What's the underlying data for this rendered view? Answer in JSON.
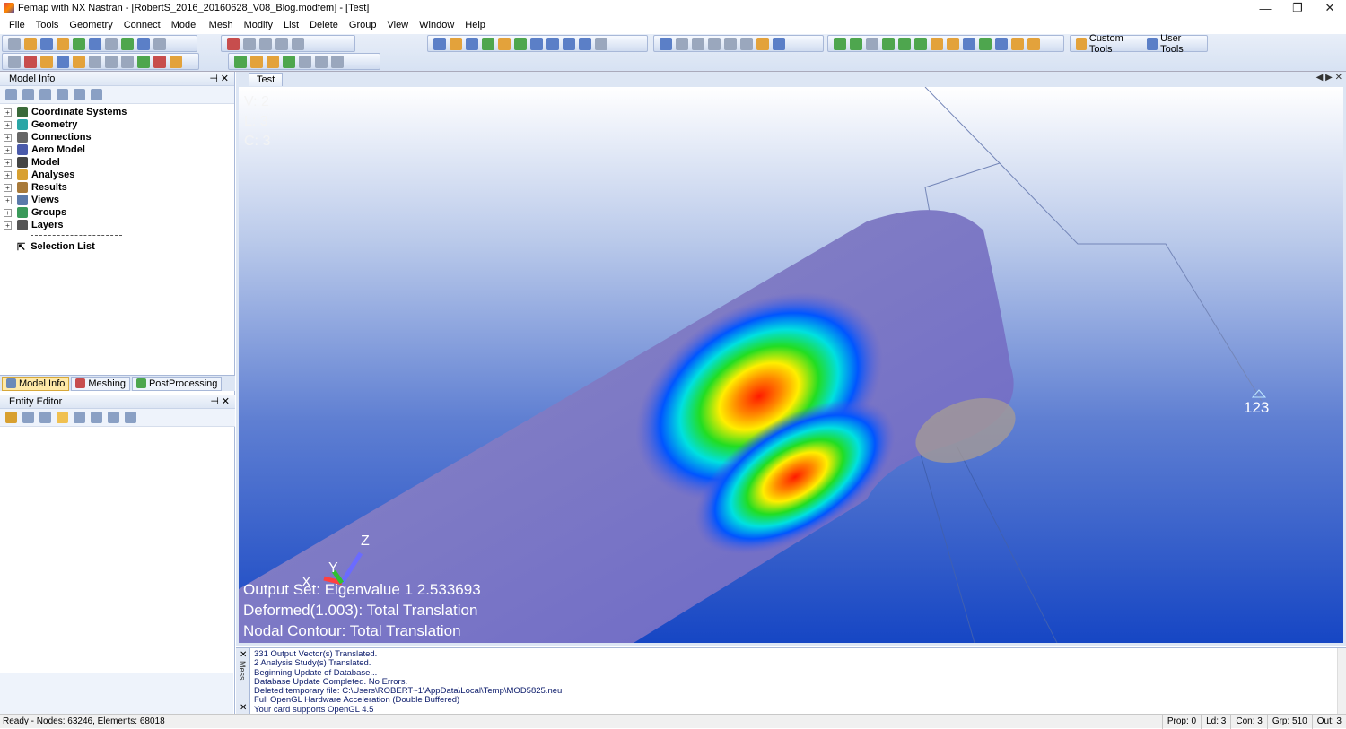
{
  "window": {
    "title": "Femap with NX Nastran - [RobertS_2016_20160628_V08_Blog.modfem] - [Test]",
    "controls": [
      "—",
      "❐",
      "✕"
    ]
  },
  "menu": [
    "File",
    "Tools",
    "Geometry",
    "Connect",
    "Model",
    "Mesh",
    "Modify",
    "List",
    "Delete",
    "Group",
    "View",
    "Window",
    "Help"
  ],
  "toolbar": {
    "custom_tools": "Custom Tools",
    "user_tools": "User Tools"
  },
  "model_info": {
    "title": "Model Info",
    "tree": [
      {
        "label": "Coordinate Systems",
        "icon": "axes-icon",
        "color": "#3a6a3a"
      },
      {
        "label": "Geometry",
        "icon": "cylinder-icon",
        "color": "#2aa6a6"
      },
      {
        "label": "Connections",
        "icon": "connection-icon",
        "color": "#666666"
      },
      {
        "label": "Aero Model",
        "icon": "aero-icon",
        "color": "#4a5aaa"
      },
      {
        "label": "Model",
        "icon": "grid-icon",
        "color": "#444444"
      },
      {
        "label": "Analyses",
        "icon": "analysis-icon",
        "color": "#d8a030"
      },
      {
        "label": "Results",
        "icon": "results-icon",
        "color": "#a87a3a"
      },
      {
        "label": "Views",
        "icon": "views-icon",
        "color": "#5a7aaa"
      },
      {
        "label": "Groups",
        "icon": "groups-icon",
        "color": "#3a9a5a"
      },
      {
        "label": "Layers",
        "icon": "layers-icon",
        "color": "#555555"
      }
    ],
    "selection_list": "Selection List"
  },
  "bottom_tabs": [
    {
      "label": "Model Info",
      "active": true
    },
    {
      "label": "Meshing",
      "active": false
    },
    {
      "label": "PostProcessing",
      "active": false
    }
  ],
  "entity_editor": {
    "title": "Entity Editor"
  },
  "viewport": {
    "tab": "Test",
    "hud": [
      "V: 2",
      "L: 3",
      "C: 3"
    ],
    "node_label": "123",
    "axes": {
      "x": "X",
      "y": "Y",
      "z": "Z"
    },
    "overlay": [
      "Output Set: Eigenvalue 1  2.533693",
      "Deformed(1.003): Total Translation",
      "Nodal Contour: Total Translation"
    ]
  },
  "messages": {
    "side_label": "Mess",
    "lines": [
      "331 Output Vector(s) Translated.",
      "2 Analysis Study(s) Translated.",
      "Beginning Update of Database...",
      "Database Update Completed. No Errors.",
      "Deleted temporary file: C:\\Users\\ROBERT~1\\AppData\\Local\\Temp\\MOD5825.neu",
      "Full OpenGL Hardware Acceleration (Double Buffered)",
      "Your card supports OpenGL 4.5"
    ]
  },
  "status": {
    "left": "Ready - Nodes: 63246,  Elements: 68018",
    "cells": [
      "Prop: 0",
      "Ld: 3",
      "Con: 3",
      "Grp: 510",
      "Out: 3"
    ]
  }
}
